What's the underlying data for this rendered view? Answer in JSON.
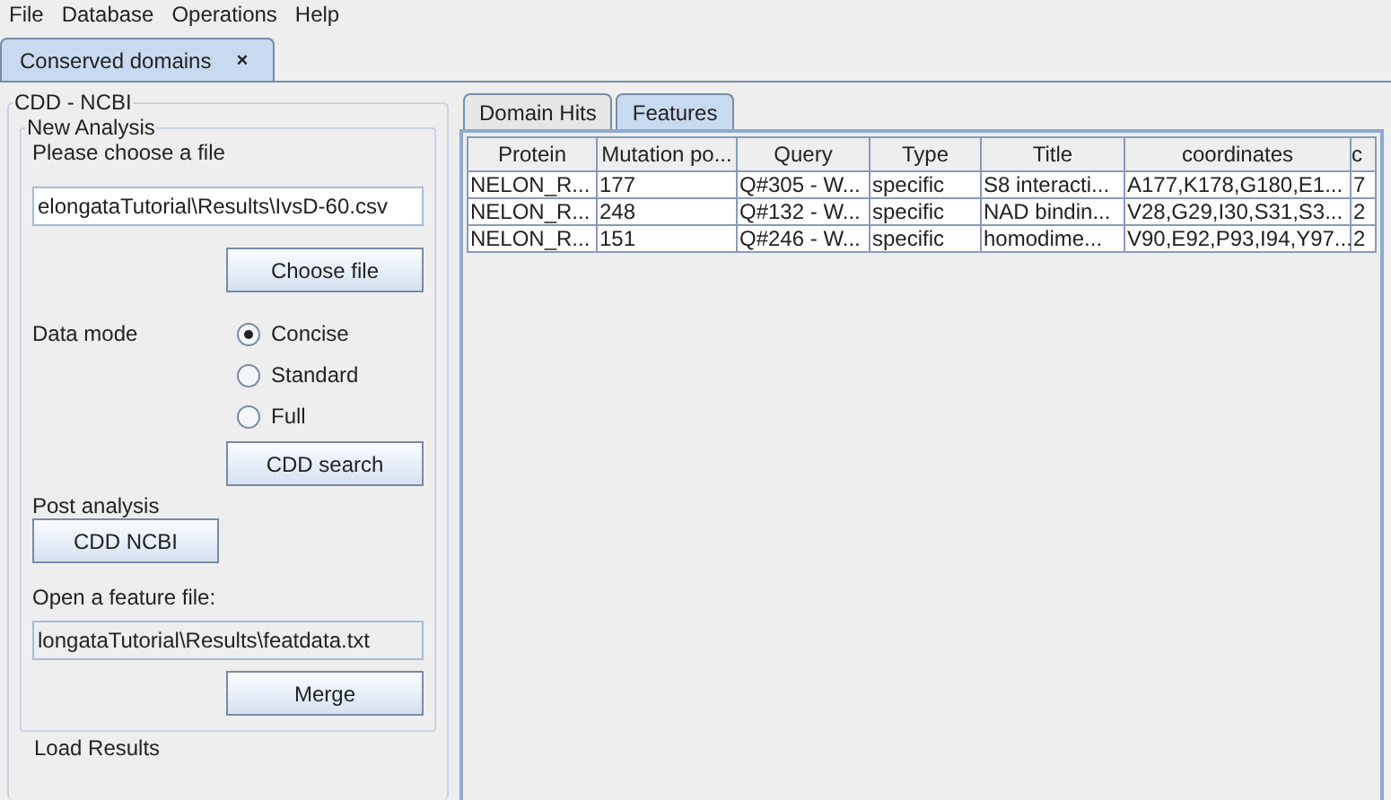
{
  "menu": [
    "File",
    "Database",
    "Operations",
    "Help"
  ],
  "doc_tabs": [
    {
      "label": "Conserved domains",
      "close": "×",
      "selected": true
    }
  ],
  "panel": {
    "title": "CDD - NCBI",
    "analysis": {
      "title": "New Analysis",
      "choose_label": "Please choose a file",
      "file_value": "elongataTutorial\\Results\\IvsD-60.csv",
      "choose_button": "Choose file",
      "data_mode_label": "Data mode",
      "modes": [
        {
          "label": "Concise",
          "selected": true
        },
        {
          "label": "Standard",
          "selected": false
        },
        {
          "label": "Full",
          "selected": false
        }
      ],
      "search_button": "CDD search",
      "post_label": "Post analysis",
      "ncbi_button": "CDD NCBI",
      "feature_label": "Open a feature file:",
      "feature_value": "longataTutorial\\Results\\featdata.txt",
      "merge_button": "Merge"
    },
    "load_title": "Load Results"
  },
  "result_tabs": [
    {
      "label": "Domain Hits",
      "selected": false
    },
    {
      "label": "Features",
      "selected": true
    }
  ],
  "table": {
    "columns": [
      "Protein",
      "Mutation po...",
      "Query",
      "Type",
      "Title",
      "coordinates",
      "c"
    ],
    "rows": [
      [
        "NELON_R...",
        "177",
        "Q#305 - W...",
        "specific",
        "S8 interacti...",
        "A177,K178,G180,E1...",
        "7"
      ],
      [
        "NELON_R...",
        "248",
        "Q#132 - W...",
        "specific",
        "NAD bindin...",
        "V28,G29,I30,S31,S3...",
        "2"
      ],
      [
        "NELON_R...",
        "151",
        "Q#246 - W...",
        "specific",
        "homodime...",
        "V90,E92,P93,I94,Y97...",
        "2"
      ]
    ]
  }
}
